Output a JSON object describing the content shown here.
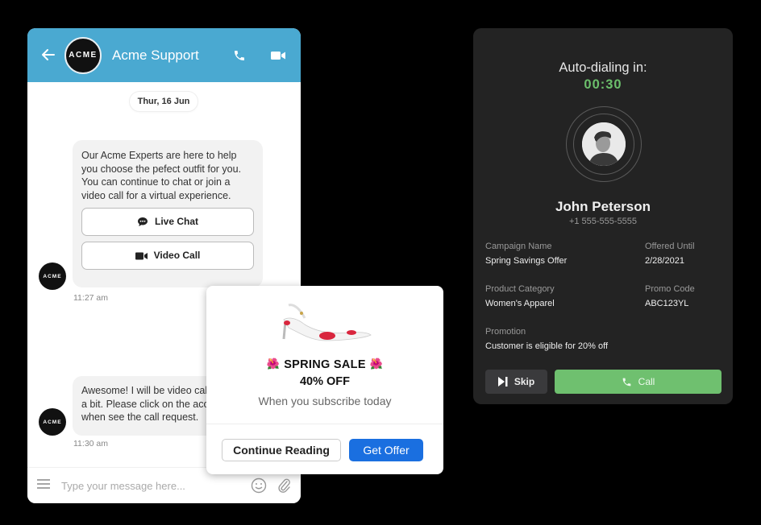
{
  "chat": {
    "header": {
      "title": "Acme Support",
      "logo_text": "ACME",
      "icons": [
        "back-arrow-icon",
        "phone-icon",
        "video-camera-icon"
      ]
    },
    "date_divider": "Thur, 16 Jun",
    "messages": [
      {
        "sender": "ACME",
        "text": "Our Acme Experts are here to help you choose the pefect outfit for you. You can continue to chat or join a video call for a virtual experience.",
        "options": [
          {
            "label": "Live Chat",
            "icon": "chat-bubble-icon"
          },
          {
            "label": "Video Call",
            "icon": "video-camera-icon"
          }
        ],
        "time": "11:27 am"
      },
      {
        "sender": "ACME",
        "text": "Awesome! I will be video calling you in a bit. Please click on the accept button when see the call request.",
        "time": "11:30 am"
      }
    ],
    "composer": {
      "placeholder": "Type your message here...",
      "icons": [
        "menu-icon",
        "emoji-icon",
        "paperclip-icon"
      ]
    }
  },
  "promo": {
    "title": "SPRING SALE",
    "decoration": "🌺",
    "discount": "40% OFF",
    "subtitle": "When you subscribe today",
    "continue_label": "Continue Reading",
    "offer_label": "Get Offer"
  },
  "dialer": {
    "label": "Auto-dialing in:",
    "timer": "00:30",
    "contact_name": "John Peterson",
    "contact_phone": "+1 555-555-5555",
    "fields": {
      "campaign_name": {
        "label": "Campaign Name",
        "value": "Spring Savings Offer"
      },
      "offered_until": {
        "label": "Offered Until",
        "value": "2/28/2021"
      },
      "product_category": {
        "label": "Product Category",
        "value": "Women's Apparel"
      },
      "promo_code": {
        "label": "Promo Code",
        "value": "ABC123YL"
      },
      "promotion": {
        "label": "Promotion",
        "value": "Customer is eligible for 20% off"
      }
    },
    "skip_label": "Skip",
    "call_label": "Call"
  },
  "colors": {
    "chat_header": "#4aa9d1",
    "offer_button": "#1a6fe0",
    "call_button": "#6fc06f",
    "timer": "#6bbf6b",
    "dialer_bg": "#232323"
  }
}
